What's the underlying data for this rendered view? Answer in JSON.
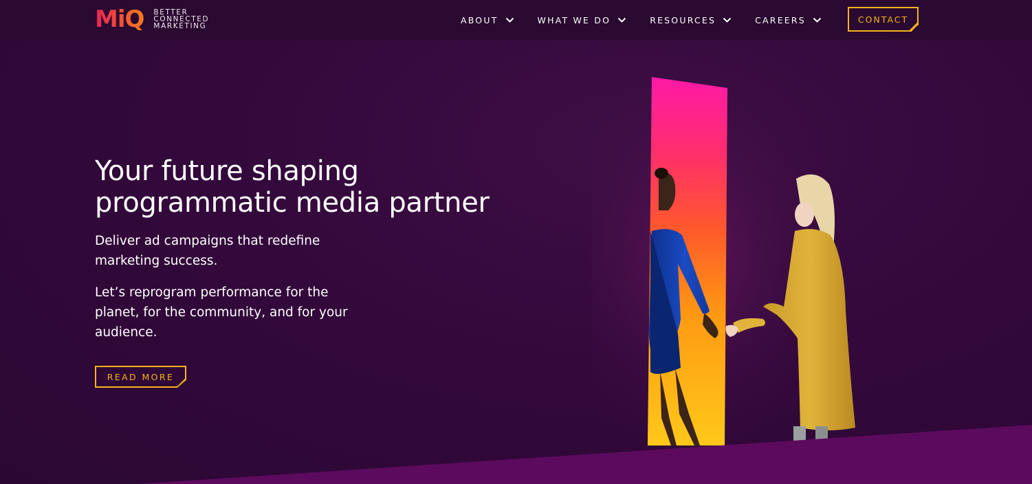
{
  "header": {
    "logo": {
      "mark": "MiQ",
      "tagline": [
        "BETTER",
        "CONNECTED",
        "MARKETING"
      ]
    },
    "nav": [
      {
        "label": "ABOUT"
      },
      {
        "label": "WHAT WE DO"
      },
      {
        "label": "RESOURCES"
      },
      {
        "label": "CAREERS"
      }
    ],
    "contact_label": "CONTACT"
  },
  "hero": {
    "title_line1": "Your future shaping",
    "title_line2": "programmatic media partner",
    "subtitle": "Deliver ad campaigns that redefine marketing success.",
    "body": "Let’s reprogram performance for the planet, for the community, and for your audience.",
    "cta_label": "READ MORE"
  },
  "colors": {
    "background": "#33093b",
    "header_bg": "#2a0a30",
    "accent": "#f5b51d",
    "band": "#5c0a5e"
  },
  "icons": {
    "nav_chevron": "chevron-down-icon"
  }
}
